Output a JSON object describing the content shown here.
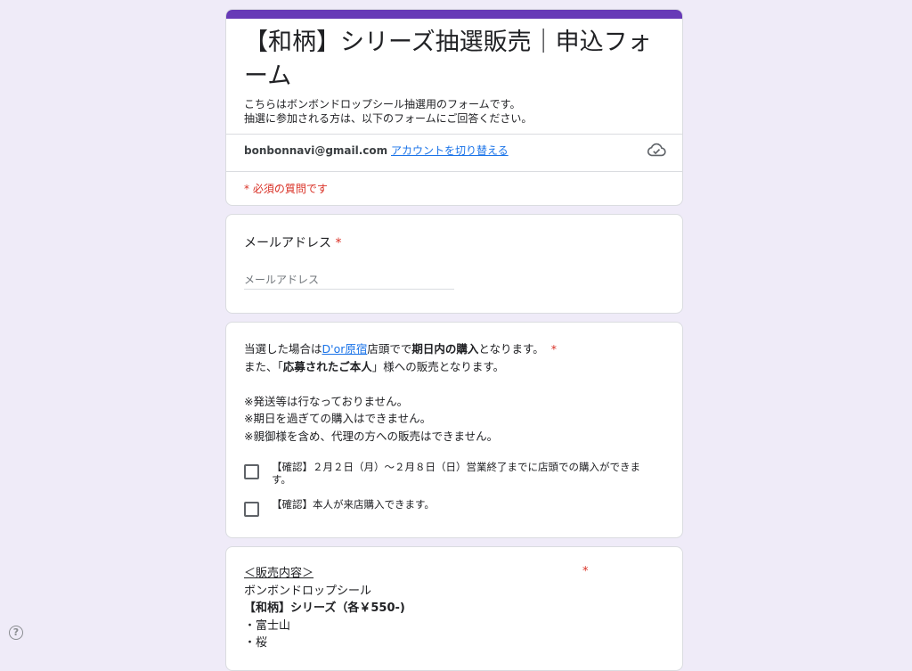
{
  "form": {
    "title": "【和柄】シリーズ抽選販売｜申込フォーム",
    "description_lines": [
      "こちらはボンボンドロップシール抽選用のフォームです。",
      "抽選に参加される方は、以下のフォームにご回答ください。"
    ],
    "account_email": "bonbonnavi@gmail.com",
    "switch_account_label": "アカウントを切り替える",
    "required_note": "* 必須の質問です",
    "accent_color": "#673ab7"
  },
  "email_question": {
    "label": "メールアドレス",
    "required_mark": "*",
    "placeholder": "メールアドレス"
  },
  "confirm_question": {
    "line1_pre": "当選した場合は",
    "line1_link": "D'or原宿",
    "line1_mid": "店頭でで",
    "line1_bold": "期日内の購入",
    "line1_post": "となります。",
    "required_mark": "*",
    "line2_pre": "また、「",
    "line2_bold": "応募されたご本人",
    "line2_post": "」様への販売となります。",
    "notes": [
      "※発送等は行なっておりません。",
      "※期日を過ぎての購入はできません。",
      "※親御様を含め、代理の方への販売はできません。"
    ],
    "options": [
      "【確認】２月２日（月）～２月８日（日）営業終了までに店頭での購入ができます。",
      "【確認】本人が来店購入できます。"
    ]
  },
  "sale_question": {
    "heading": "＜販売内容＞",
    "product": "ボンボンドロップシール",
    "series": "【和柄】シリーズ（各￥550-)",
    "items": [
      "・富士山",
      "・桜"
    ],
    "required_mark": "*"
  },
  "help": {
    "icon": "help-icon",
    "glyph": "?"
  }
}
